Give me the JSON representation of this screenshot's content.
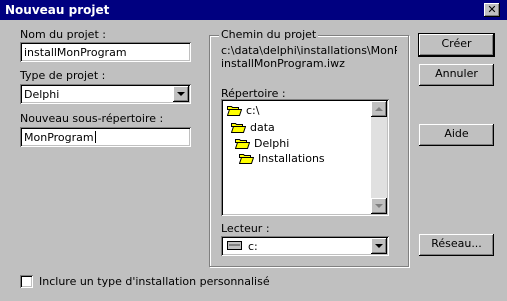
{
  "window": {
    "title": "Nouveau projet",
    "close_glyph": "✕"
  },
  "fields": {
    "name": {
      "label": "Nom du projet :",
      "value": "installMonProgram"
    },
    "type": {
      "label": "Type de projet :",
      "value": "Delphi"
    },
    "subdir": {
      "label": "Nouveau sous-répertoire :",
      "value": "MonProgram"
    }
  },
  "path_group": {
    "title": "Chemin du projet",
    "line1": "c:\\data\\delphi\\installations\\MonProgr",
    "line2": "installMonProgram.iwz",
    "dir_label": "Répertoire :",
    "tree": [
      {
        "label": "c:\\",
        "open": true
      },
      {
        "label": "data",
        "open": true
      },
      {
        "label": "Delphi",
        "open": true
      },
      {
        "label": "Installations",
        "open": true
      }
    ],
    "drive_label": "Lecteur :",
    "drive_value": "c:"
  },
  "buttons": {
    "create": "Créer",
    "cancel": "Annuler",
    "help": "Aide",
    "network": "Réseau..."
  },
  "checkbox": {
    "label": "Inclure un type d'installation personnalisé",
    "checked": false
  },
  "colors": {
    "face": "#c0c0c0",
    "titlebar": "#000080",
    "folder": "#ffff00"
  }
}
